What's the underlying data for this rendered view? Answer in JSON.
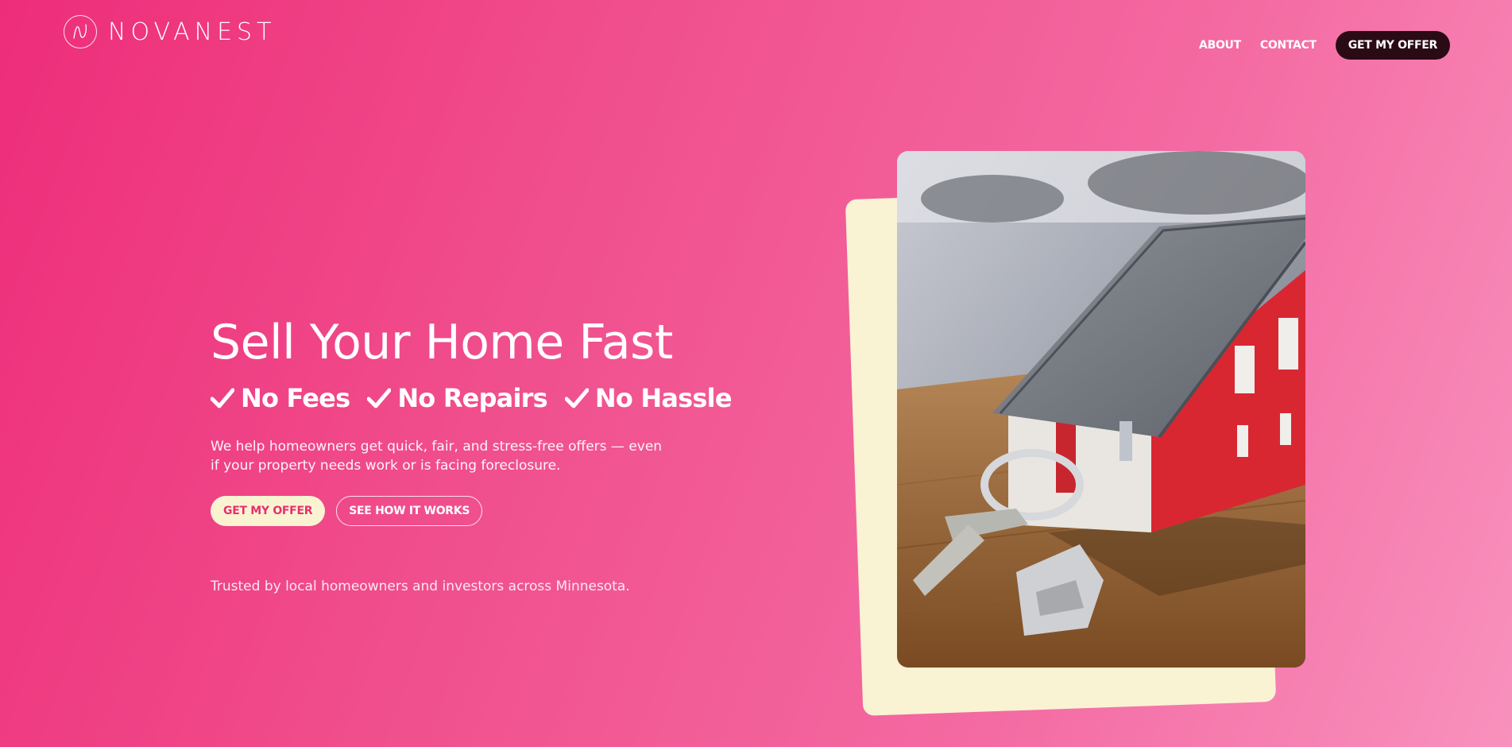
{
  "header": {
    "brand": "NOVANEST",
    "nav": [
      {
        "label": "ABOUT"
      },
      {
        "label": "CONTACT"
      }
    ],
    "cta_label": "GET MY OFFER"
  },
  "hero": {
    "title": "Sell Your Home Fast",
    "benefits": [
      "No Fees",
      "No Repairs",
      "No Hassle"
    ],
    "description": "We help homeowners get quick, fair, and stress-free offers — even if your property needs work or is facing foreclosure.",
    "primary_button": "GET MY OFFER",
    "secondary_button": "SEE HOW IT WORKS",
    "trust_text": "Trusted by local homeowners and investors across Minnesota."
  },
  "colors": {
    "accent_pink": "#ee2d7a",
    "cream": "#f9f2d3",
    "nav_cta_bg": "#2a0a14"
  },
  "icons": [
    "logo-n-icon",
    "checkmark-icon"
  ]
}
